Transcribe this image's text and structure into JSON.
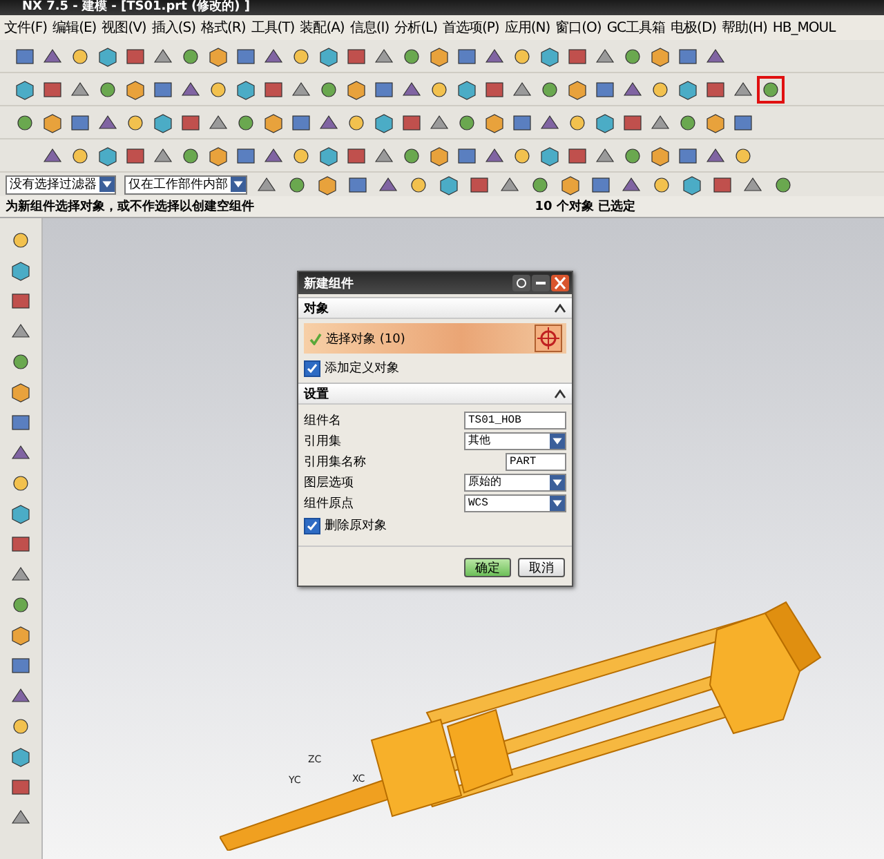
{
  "window": {
    "title": "NX 7.5 - 建模 - [TS01.prt (修改的) ]"
  },
  "menu": [
    "文件(F)",
    "编辑(E)",
    "视图(V)",
    "插入(S)",
    "格式(R)",
    "工具(T)",
    "装配(A)",
    "信息(I)",
    "分析(L)",
    "首选项(P)",
    "应用(N)",
    "窗口(O)",
    "GC工具箱",
    "电极(D)",
    "帮助(H)",
    "HB_MOUL"
  ],
  "selection_bar": {
    "filter": "没有选择过滤器",
    "scope": "仅在工作部件内部"
  },
  "status_bar": {
    "prompt": "为新组件选择对象，或不作选择以创建空组件",
    "selected": "10 个对象 已选定"
  },
  "triad": [
    "ZC",
    "YC",
    "XC"
  ],
  "dialog": {
    "title": "新建组件",
    "sections": [
      {
        "title": "对象",
        "expanded": true
      },
      {
        "title": "设置",
        "expanded": true
      }
    ],
    "select_row": {
      "label": "选择对象 (10)",
      "done": true
    },
    "add_checkbox": {
      "label": "添加定义对象",
      "checked": true
    },
    "fields": [
      {
        "kind": "input",
        "label": "组件名",
        "value": "TS01_HOB"
      },
      {
        "kind": "select",
        "label": "引用集",
        "value": "其他"
      },
      {
        "kind": "short",
        "label": "引用集名称",
        "value": "PART"
      },
      {
        "kind": "select",
        "label": "图层选项",
        "value": "原始的"
      },
      {
        "kind": "select",
        "label": "组件原点",
        "value": "WCS"
      }
    ],
    "delete_checkbox": {
      "label": "删除原对象",
      "checked": true
    },
    "buttons": [
      {
        "label": "确定",
        "default": true
      },
      {
        "label": "取消",
        "default": false
      }
    ]
  }
}
